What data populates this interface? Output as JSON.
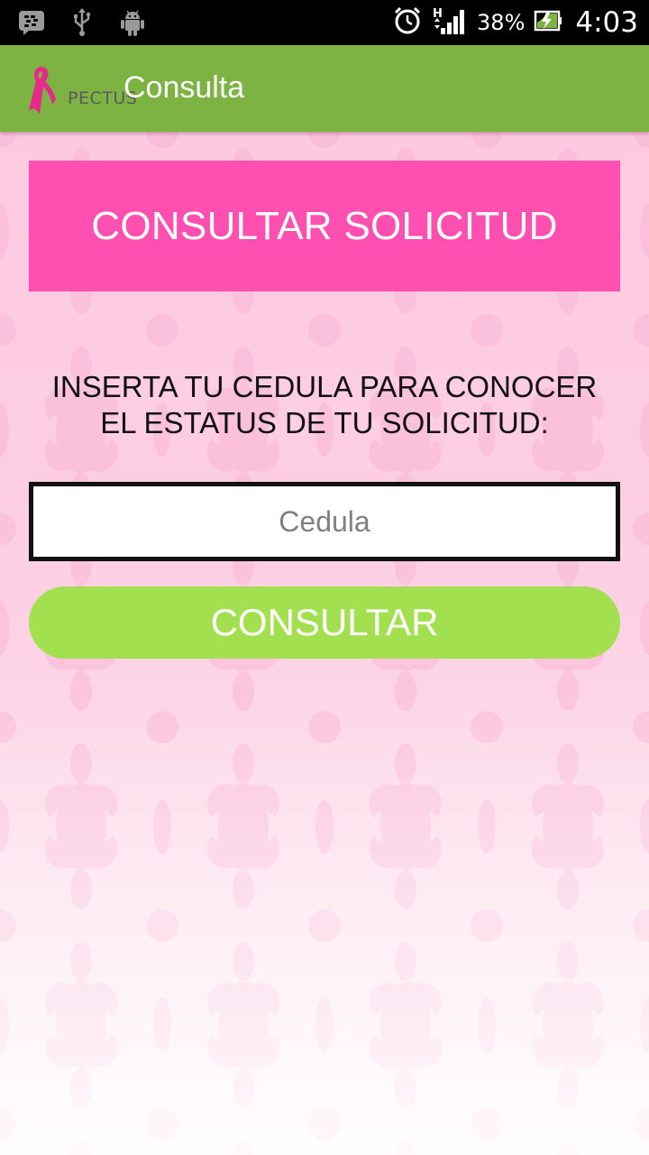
{
  "status_bar": {
    "battery_percent": "38%",
    "network_type": "H",
    "time": "4:03",
    "icons": [
      "bbm-icon",
      "usb-icon",
      "android-debug-icon",
      "alarm-clock-icon",
      "signal-icon",
      "battery-charging-icon"
    ]
  },
  "action_bar": {
    "logo_text": "PECTUS",
    "title": "Consulta",
    "color": "#7cb342"
  },
  "main": {
    "header": "CONSULTAR SOLICITUD",
    "instruction_line1": "INSERTA TU CEDULA PARA CONOCER",
    "instruction_line2": "EL ESTATUS DE TU SOLICITUD:",
    "cedula_input": {
      "placeholder": "Cedula",
      "value": ""
    },
    "submit_button": "CONSULTAR",
    "accent_pink": "#ff4fb1",
    "button_green": "#a2e050"
  }
}
